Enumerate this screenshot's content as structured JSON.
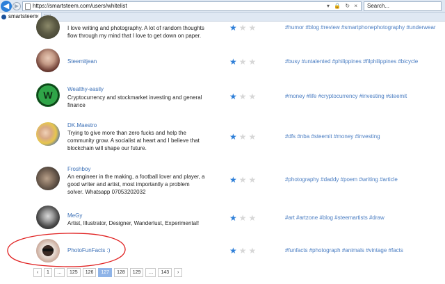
{
  "browser": {
    "url": "https://smartsteem.com/users/whitelist",
    "search_placeholder": "Search...",
    "addr_icons": "▾ 🔒 ↻ ×",
    "tab_title": "smartsteem",
    "back_icon": "back-arrow-icon",
    "forward_icon": "forward-arrow-icon"
  },
  "rows": [
    {
      "name": "",
      "desc": "I love writing and photography. A lot of random thoughts flow through my mind that I love to get down on paper.",
      "stars": 1,
      "tags": "#humor  #blog  #review  #smartphonephotography  #underwear"
    },
    {
      "name": "Steemitjean",
      "desc": "",
      "stars": 1,
      "tags": "#busy  #untalented  #philippines  #filphilippines  #bicycle"
    },
    {
      "name": "Wealthy-easily",
      "desc": "Cryptocurrency and stockmarket investing and general finance",
      "stars": 1,
      "tags": "#money  #life  #cryptocurrency  #investing  #steemit"
    },
    {
      "name": "DK.Maestro",
      "desc": "Trying to give more than zero fucks and help the community grow. A socialist at heart and I believe that blockchain will shape our future.",
      "stars": 1,
      "tags": "#dfs  #nba  #steemit  #money  #investing"
    },
    {
      "name": "Froshboy",
      "desc": "An engineer in the making, a football lover and player, a good writer and artist, most importantly a problem solver. Whatsapp 07053202032",
      "stars": 1,
      "tags": "#photography  #daddy  #poem  #writing  #article"
    },
    {
      "name": "MeGy",
      "desc": "Artist, Illustrator, Designer, Wanderlust, Experimental!",
      "stars": 1,
      "tags": "#art  #artzone  #blog  #steemartists  #draw"
    },
    {
      "name": "PhotoFunFacts :)",
      "desc": "",
      "stars": 1,
      "tags": "#funfacts  #photograph  #animals  #vintage  #facts"
    }
  ],
  "pagination": [
    "‹",
    "1",
    "…",
    "125",
    "126",
    "127",
    "128",
    "129",
    "…",
    "143",
    "›"
  ],
  "pagination_active": "127",
  "colors": {
    "accent": "#2e7fd8",
    "link": "#3a6fb6",
    "annotation": "#e02020"
  }
}
